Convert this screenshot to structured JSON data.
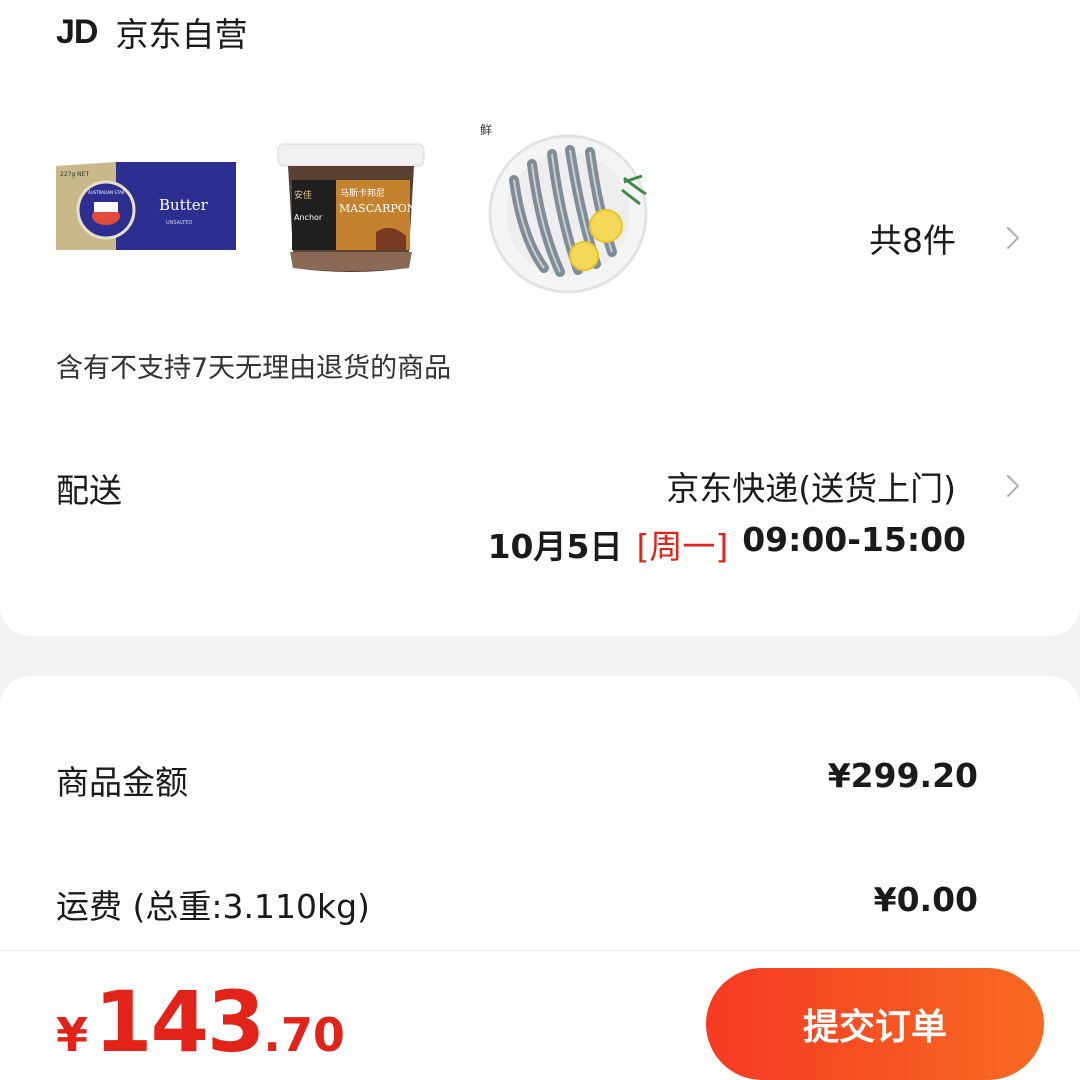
{
  "shop": {
    "logo_text": "JD",
    "name": "京东自营"
  },
  "products": {
    "items": [
      {
        "name": "butter",
        "icon": "butter-box-image",
        "label": "Butter",
        "top_label": "227g NET",
        "seal_label": "AUSTRALIAN STAR",
        "sub_label": "UNSALTED"
      },
      {
        "name": "mascarpone",
        "icon": "mascarpone-tub-image",
        "label": "MASCARPONE",
        "cn_label": "马斯卡邦尼",
        "brand": "Anchor",
        "cn_brand": "安佳"
      },
      {
        "name": "shrimp",
        "icon": "shrimp-plate-image"
      }
    ],
    "count_text": "共8件"
  },
  "notice": "含有不支持7天无理由退货的商品",
  "delivery": {
    "label": "配送",
    "method": "京东快递(送货上门)",
    "date": "10月5日",
    "weekday": "[周一]",
    "time": "09:00-15:00"
  },
  "summary": {
    "goods_label": "商品金额",
    "goods_value": "¥299.20",
    "shipping_label": "运费  (总重:3.110kg)",
    "shipping_value": "¥0.00"
  },
  "footer": {
    "currency": "¥",
    "total_int": "143",
    "total_dec": ".70",
    "submit_label": "提交订单"
  },
  "colors": {
    "accent_red": "#e2231a",
    "button_gradient_start": "#f53a24",
    "button_gradient_end": "#f86a21",
    "background": "#f2f2f2"
  }
}
